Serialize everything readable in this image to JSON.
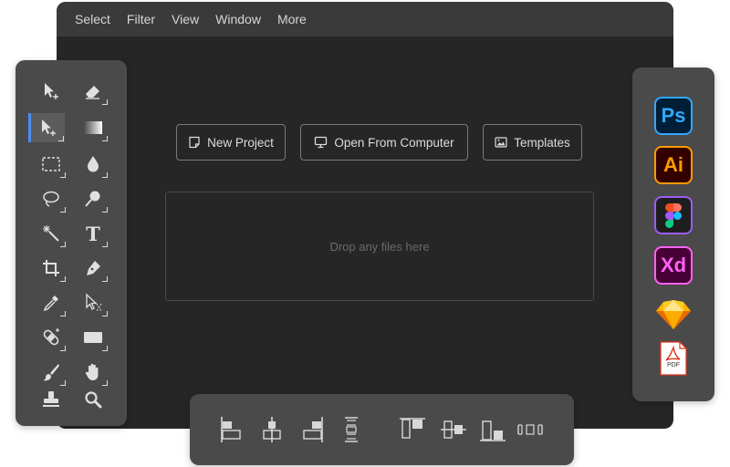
{
  "menu": [
    "Select",
    "Filter",
    "View",
    "Window",
    "More"
  ],
  "actions": {
    "new_project": "New Project",
    "open_computer": "Open From Computer",
    "templates": "Templates"
  },
  "dropzone": {
    "text": "Drop any files here"
  },
  "apps": {
    "photoshop": "Ps",
    "illustrator": "Ai",
    "xd": "Xd",
    "pdf": "PDF"
  },
  "tools": [
    "move-tool",
    "eraser-tool",
    "select-tool",
    "gradient-tool",
    "marquee-tool",
    "blur-tool",
    "lasso-tool",
    "dodge-tool",
    "magic-wand-tool",
    "type-tool",
    "crop-tool",
    "pen-tool",
    "eyedropper-tool",
    "path-select-tool",
    "healing-tool",
    "rectangle-tool",
    "brush-tool",
    "hand-tool",
    "stamp-tool",
    "zoom-tool"
  ],
  "align_tools": [
    "align-left",
    "align-horizontal-center",
    "align-right",
    "distribute-vertical",
    "align-top",
    "align-vertical-center",
    "align-bottom",
    "distribute-horizontal"
  ],
  "colors": {
    "window_bg": "#262626",
    "menubar_bg": "#3a3a3a",
    "panel_bg": "#4a4a4a",
    "active_accent": "#4d8cf5",
    "photoshop": "#31a8ff",
    "illustrator": "#ff9a00",
    "xd": "#ff61f6",
    "figma_border": "#9d5cf7",
    "sketch": "#fdad00",
    "pdf": "#e0331f"
  }
}
